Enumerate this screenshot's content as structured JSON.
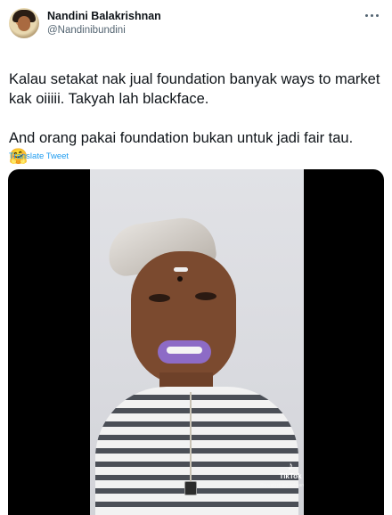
{
  "tweet": {
    "display_name": "Nandini Balakrishnan",
    "handle": "@Nandinibundini",
    "body": "Kalau setakat nak jual foundation banyak ways to market kak oiiiii. Takyah lah blackface.\n\nAnd orang pakai foundation bukan untuk jadi fair tau.",
    "emoji": "🤗",
    "translate_label": "Translate Tweet"
  },
  "media": {
    "watermark_brand": "TikTok",
    "watermark_handle": "@nandinibalakrishnan"
  },
  "icons": {
    "more": "more-horizontal-icon",
    "tiktok": "tiktok-note-icon"
  },
  "colors": {
    "link": "#1d9bf0",
    "text": "#0f1419",
    "secondary": "#536471"
  }
}
